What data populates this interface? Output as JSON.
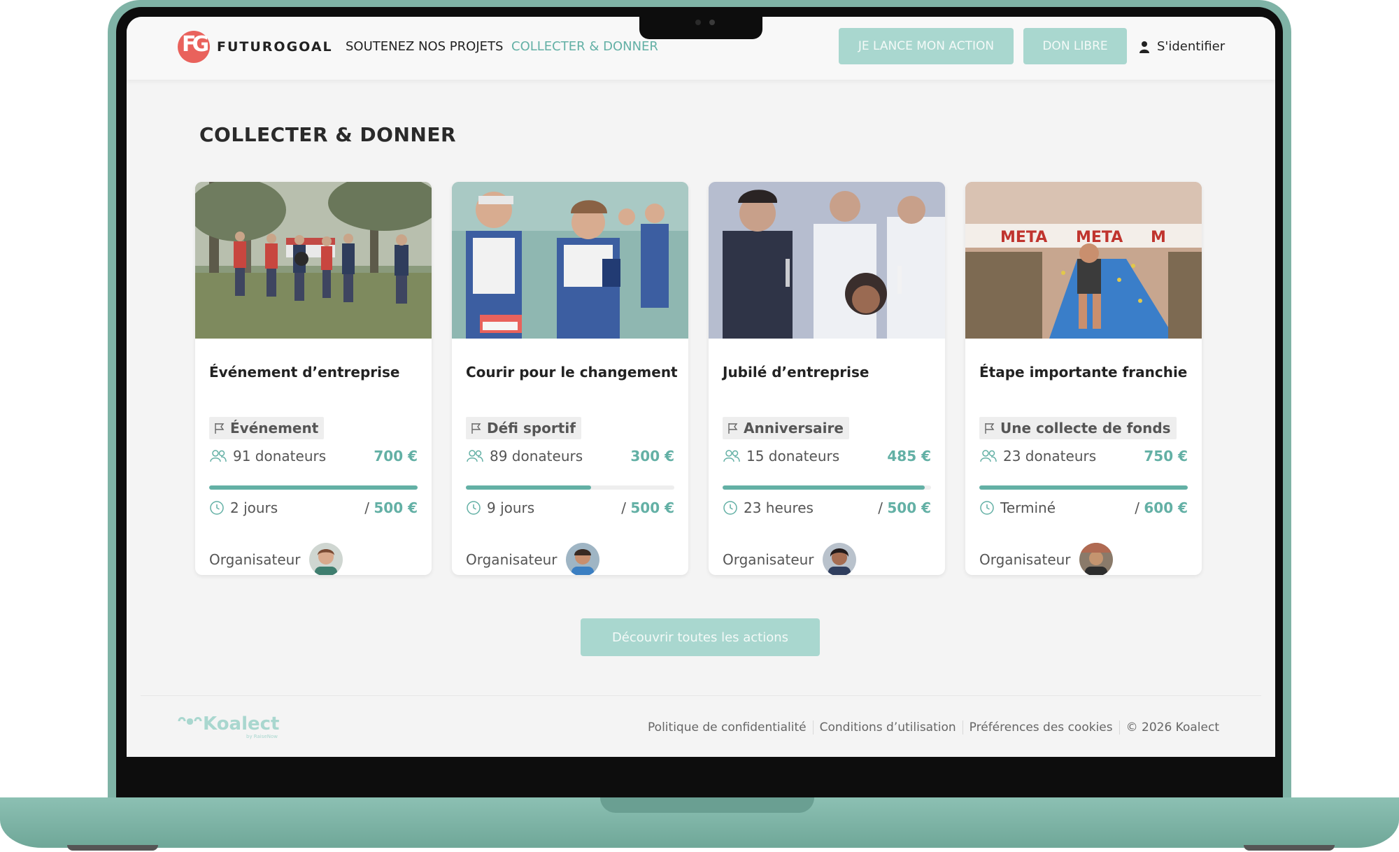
{
  "colors": {
    "accent": "#63b0a5",
    "accent_light": "#a9d7cf",
    "brand": "#e9625c",
    "laptop": "#7fb3a6"
  },
  "header": {
    "logo_text": "FUTUROGOAL",
    "nav": [
      "SOUTENEZ NOS PROJETS",
      "COLLECTER & DONNER"
    ],
    "btn_launch": "JE LANCE MON ACTION",
    "btn_donate": "DON LIBRE",
    "login": "S'identifier"
  },
  "page": {
    "title": "COLLECTER & DONNER",
    "discover": "Découvrir toutes les actions"
  },
  "cards": [
    {
      "title": "Événement d’entreprise",
      "tag": "Événement",
      "donors": "91 donateurs",
      "amount": "700 €",
      "time": "2 jours",
      "goal": "500 €",
      "organizer": "Organisateur",
      "progress": 1.0,
      "photo": "teambuilding-photo"
    },
    {
      "title": "Courir pour le changement",
      "tag": "Défi sportif",
      "donors": "89 donateurs",
      "amount": "300 €",
      "time": "9 jours",
      "goal": "500 €",
      "organizer": "Organisateur",
      "progress": 0.6,
      "photo": "marathon-photo"
    },
    {
      "title": "Jubilé d’entreprise",
      "tag": "Anniversaire",
      "donors": "15 donateurs",
      "amount": "485 €",
      "time": "23 heures",
      "goal": "500 €",
      "organizer": "Organisateur",
      "progress": 0.97,
      "photo": "celebration-photo"
    },
    {
      "title": "Étape importante franchie",
      "tag": "Une collecte de fonds",
      "donors": "23 donateurs",
      "amount": "750 €",
      "time": "Terminé",
      "goal": "600 €",
      "organizer": "Organisateur",
      "progress": 1.0,
      "photo": "finish-line-photo"
    }
  ],
  "footer": {
    "brand": "Koalect",
    "brand_sub": "by RaiseNow",
    "links": [
      "Politique de confidentialité",
      "Conditions d’utilisation",
      "Préférences des cookies",
      "© 2026 Koalect"
    ]
  }
}
